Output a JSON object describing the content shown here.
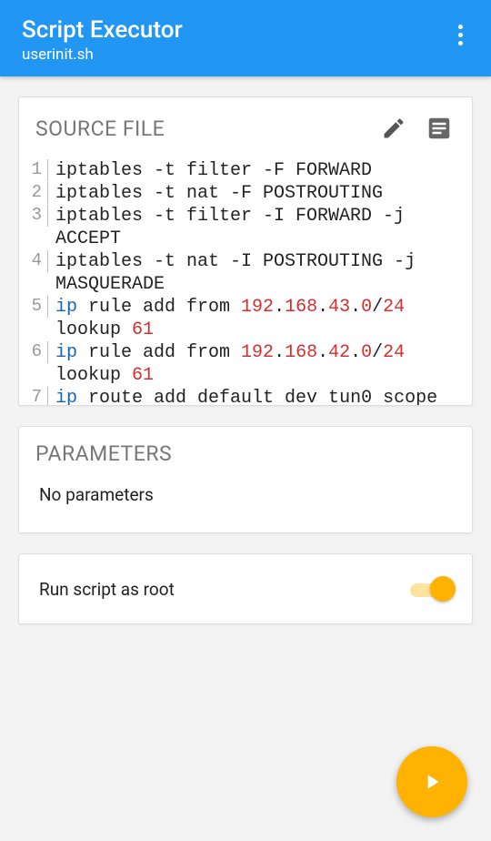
{
  "appbar": {
    "title": "Script Executor",
    "subtitle": "userinit.sh"
  },
  "source": {
    "title": "SOURCE FILE",
    "lines": [
      {
        "n": 1,
        "segments": [
          {
            "t": "iptables -t filter -F FORWARD",
            "c": ""
          }
        ]
      },
      {
        "n": 2,
        "segments": [
          {
            "t": "iptables -t nat -F POSTROUTING",
            "c": ""
          }
        ]
      },
      {
        "n": 3,
        "segments": [
          {
            "t": "iptables -t filter -I FORWARD -j ACCEPT",
            "c": ""
          }
        ]
      },
      {
        "n": 4,
        "segments": [
          {
            "t": "iptables -t nat -I POSTROUTING -j MASQUERADE",
            "c": ""
          }
        ]
      },
      {
        "n": 5,
        "segments": [
          {
            "t": "ip",
            "c": "kw"
          },
          {
            "t": " rule add from ",
            "c": ""
          },
          {
            "t": "192",
            "c": "ip"
          },
          {
            "t": ".",
            "c": ""
          },
          {
            "t": "168",
            "c": "ip"
          },
          {
            "t": ".",
            "c": ""
          },
          {
            "t": "43",
            "c": "ip"
          },
          {
            "t": ".",
            "c": ""
          },
          {
            "t": "0",
            "c": "ip"
          },
          {
            "t": "/",
            "c": ""
          },
          {
            "t": "24",
            "c": "ip"
          },
          {
            "t": " lookup ",
            "c": ""
          },
          {
            "t": "61",
            "c": "num"
          }
        ]
      },
      {
        "n": 6,
        "segments": [
          {
            "t": "ip",
            "c": "kw"
          },
          {
            "t": " rule add from ",
            "c": ""
          },
          {
            "t": "192",
            "c": "ip"
          },
          {
            "t": ".",
            "c": ""
          },
          {
            "t": "168",
            "c": "ip"
          },
          {
            "t": ".",
            "c": ""
          },
          {
            "t": "42",
            "c": "ip"
          },
          {
            "t": ".",
            "c": ""
          },
          {
            "t": "0",
            "c": "ip"
          },
          {
            "t": "/",
            "c": ""
          },
          {
            "t": "24",
            "c": "ip"
          },
          {
            "t": " lookup ",
            "c": ""
          },
          {
            "t": "61",
            "c": "num"
          }
        ]
      },
      {
        "n": 7,
        "segments": [
          {
            "t": "ip",
            "c": "kw"
          },
          {
            "t": " route add default dev tun0 scope",
            "c": ""
          }
        ]
      }
    ]
  },
  "parameters": {
    "title": "PARAMETERS",
    "empty": "No parameters"
  },
  "root": {
    "label": "Run script as root",
    "enabled": true
  }
}
